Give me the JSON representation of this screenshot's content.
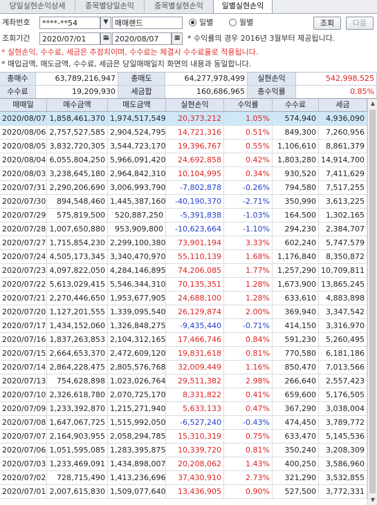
{
  "tabs": [
    "당일실현손익상세",
    "종목별당일손익",
    "종목별실현손익",
    "일별실현손익"
  ],
  "form": {
    "account_label": "계좌번호",
    "account_value": "****-**54",
    "account_name": "매매랜드",
    "radio_daily": "일별",
    "radio_monthly": "월별",
    "query_button": "조회",
    "next_button": "다음",
    "period_label": "조회기간",
    "date_from": "2020/07/01",
    "date_to": "2020/08/07",
    "tilde": "~",
    "period_note": "* 수익률의 경우 2016년 3월부터 제공됩니다."
  },
  "notes": {
    "red": "* 실현손익, 수수료, 세금은 추정치이며, 수수료는 체결시 수수료율로 적용됩니다.",
    "black": "* 매입금액, 매도금액, 수수료, 세금은 당일매매일지 화면의 내용과 동일합니다."
  },
  "summary": {
    "total_buy_label": "총매수",
    "total_buy": "63,789,216,947",
    "total_sell_label": "총매도",
    "total_sell": "64,277,978,499",
    "realized_label": "실현손익",
    "realized": "542,998,525",
    "fee_label": "수수료",
    "fee": "19,209,930",
    "tax_label": "세금합",
    "tax": "160,686,965",
    "return_label": "총수익률",
    "return": "0.85%"
  },
  "columns": [
    "매매일",
    "매수금액",
    "매도금액",
    "실현손익",
    "수익률",
    "수수료",
    "세금"
  ],
  "rows": [
    {
      "date": "2020/08/07",
      "buy": "1,858,461,370",
      "sell": "1,974,517,549",
      "pnl": "20,373,212",
      "ret": "1.05%",
      "fee": "574,940",
      "tax": "4,936,090",
      "neg": false
    },
    {
      "date": "2020/08/06",
      "buy": "2,757,527,585",
      "sell": "2,904,524,795",
      "pnl": "14,721,316",
      "ret": "0.51%",
      "fee": "849,300",
      "tax": "7,260,956",
      "neg": false
    },
    {
      "date": "2020/08/05",
      "buy": "3,832,720,305",
      "sell": "3,544,723,170",
      "pnl": "19,396,767",
      "ret": "0.55%",
      "fee": "1,106,610",
      "tax": "8,861,379",
      "neg": false
    },
    {
      "date": "2020/08/04",
      "buy": "6,055,804,250",
      "sell": "5,966,091,420",
      "pnl": "24,692,858",
      "ret": "0.42%",
      "fee": "1,803,280",
      "tax": "14,914,700",
      "neg": false
    },
    {
      "date": "2020/08/03",
      "buy": "3,238,645,180",
      "sell": "2,964,842,310",
      "pnl": "10,104,995",
      "ret": "0.34%",
      "fee": "930,520",
      "tax": "7,411,629",
      "neg": false
    },
    {
      "date": "2020/07/31",
      "buy": "2,290,206,690",
      "sell": "3,006,993,790",
      "pnl": "-7,802,878",
      "ret": "-0.26%",
      "fee": "794,580",
      "tax": "7,517,255",
      "neg": true
    },
    {
      "date": "2020/07/30",
      "buy": "894,548,460",
      "sell": "1,445,387,160",
      "pnl": "-40,190,370",
      "ret": "-2.71%",
      "fee": "350,990",
      "tax": "3,613,225",
      "neg": true
    },
    {
      "date": "2020/07/29",
      "buy": "575,819,500",
      "sell": "520,887,250",
      "pnl": "-5,391,838",
      "ret": "-1.03%",
      "fee": "164,500",
      "tax": "1,302,165",
      "neg": true
    },
    {
      "date": "2020/07/28",
      "buy": "1,007,650,880",
      "sell": "953,909,800",
      "pnl": "-10,623,664",
      "ret": "-1.10%",
      "fee": "294,230",
      "tax": "2,384,707",
      "neg": true
    },
    {
      "date": "2020/07/27",
      "buy": "1,715,854,230",
      "sell": "2,299,100,380",
      "pnl": "73,901,194",
      "ret": "3.33%",
      "fee": "602,240",
      "tax": "5,747,579",
      "neg": false
    },
    {
      "date": "2020/07/24",
      "buy": "4,505,173,345",
      "sell": "3,340,470,970",
      "pnl": "55,110,139",
      "ret": "1.68%",
      "fee": "1,176,840",
      "tax": "8,350,872",
      "neg": false
    },
    {
      "date": "2020/07/23",
      "buy": "4,097,822,050",
      "sell": "4,284,146,895",
      "pnl": "74,206,085",
      "ret": "1.77%",
      "fee": "1,257,290",
      "tax": "10,709,811",
      "neg": false
    },
    {
      "date": "2020/07/22",
      "buy": "5,613,029,415",
      "sell": "5,546,344,310",
      "pnl": "70,135,351",
      "ret": "1.28%",
      "fee": "1,673,900",
      "tax": "13,865,245",
      "neg": false
    },
    {
      "date": "2020/07/21",
      "buy": "2,270,446,650",
      "sell": "1,953,677,905",
      "pnl": "24,688,100",
      "ret": "1.28%",
      "fee": "633,610",
      "tax": "4,883,898",
      "neg": false
    },
    {
      "date": "2020/07/20",
      "buy": "1,127,201,555",
      "sell": "1,339,095,540",
      "pnl": "26,129,874",
      "ret": "2.00%",
      "fee": "369,940",
      "tax": "3,347,542",
      "neg": false
    },
    {
      "date": "2020/07/17",
      "buy": "1,434,152,060",
      "sell": "1,326,848,275",
      "pnl": "-9,435,440",
      "ret": "-0.71%",
      "fee": "414,150",
      "tax": "3,316,970",
      "neg": true
    },
    {
      "date": "2020/07/16",
      "buy": "1,837,263,853",
      "sell": "2,104,312,165",
      "pnl": "17,466,746",
      "ret": "0.84%",
      "fee": "591,230",
      "tax": "5,260,495",
      "neg": false
    },
    {
      "date": "2020/07/15",
      "buy": "2,664,653,370",
      "sell": "2,472,609,120",
      "pnl": "19,831,618",
      "ret": "0.81%",
      "fee": "770,580",
      "tax": "6,181,186",
      "neg": false
    },
    {
      "date": "2020/07/14",
      "buy": "2,864,228,475",
      "sell": "2,805,576,768",
      "pnl": "32,009,449",
      "ret": "1.16%",
      "fee": "850,470",
      "tax": "7,013,566",
      "neg": false
    },
    {
      "date": "2020/07/13",
      "buy": "754,628,898",
      "sell": "1,023,026,764",
      "pnl": "29,511,382",
      "ret": "2.98%",
      "fee": "266,640",
      "tax": "2,557,423",
      "neg": false
    },
    {
      "date": "2020/07/10",
      "buy": "2,326,618,780",
      "sell": "2,070,725,170",
      "pnl": "8,331,822",
      "ret": "0.41%",
      "fee": "659,600",
      "tax": "5,176,505",
      "neg": false
    },
    {
      "date": "2020/07/09",
      "buy": "1,233,392,870",
      "sell": "1,215,271,940",
      "pnl": "5,633,133",
      "ret": "0.47%",
      "fee": "367,290",
      "tax": "3,038,004",
      "neg": false
    },
    {
      "date": "2020/07/08",
      "buy": "1,647,067,725",
      "sell": "1,515,992,050",
      "pnl": "-6,527,240",
      "ret": "-0.43%",
      "fee": "474,450",
      "tax": "3,789,772",
      "neg": true
    },
    {
      "date": "2020/07/07",
      "buy": "2,164,903,955",
      "sell": "2,058,294,785",
      "pnl": "15,310,319",
      "ret": "0.75%",
      "fee": "633,470",
      "tax": "5,145,536",
      "neg": false
    },
    {
      "date": "2020/07/06",
      "buy": "1,051,595,085",
      "sell": "1,283,395,875",
      "pnl": "10,339,720",
      "ret": "0.81%",
      "fee": "350,240",
      "tax": "3,208,309",
      "neg": false
    },
    {
      "date": "2020/07/03",
      "buy": "1,233,469,091",
      "sell": "1,434,898,007",
      "pnl": "20,208,062",
      "ret": "1.43%",
      "fee": "400,250",
      "tax": "3,586,960",
      "neg": false
    },
    {
      "date": "2020/07/02",
      "buy": "728,715,490",
      "sell": "1,413,236,696",
      "pnl": "37,430,910",
      "ret": "2.73%",
      "fee": "321,290",
      "tax": "3,532,855",
      "neg": false
    },
    {
      "date": "2020/07/01",
      "buy": "2,007,615,830",
      "sell": "1,509,077,640",
      "pnl": "13,436,905",
      "ret": "0.90%",
      "fee": "527,500",
      "tax": "3,772,331",
      "neg": false
    }
  ],
  "icons": {
    "combo": "chevron-down-icon",
    "calendar": "calendar-icon",
    "scroll_up": "arrow-up-icon",
    "scroll_down": "arrow-down-icon"
  },
  "colors": {
    "positive": "#e02020",
    "negative": "#2040d0",
    "header_bg": "#dfe6f2",
    "selected_row": "#cfe8f8"
  }
}
